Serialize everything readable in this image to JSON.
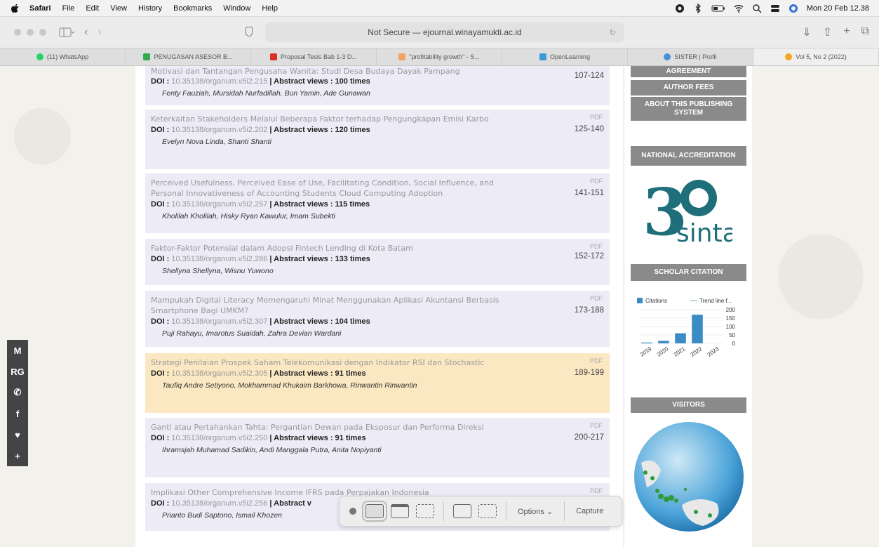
{
  "menubar": {
    "items": [
      "Safari",
      "File",
      "Edit",
      "View",
      "History",
      "Bookmarks",
      "Window",
      "Help"
    ],
    "datetime": "Mon 20 Feb 12.38"
  },
  "toolbar": {
    "address": "Not Secure — ejournal.winayamukti.ac.id"
  },
  "tabs": [
    {
      "label": "(11) WhatsApp",
      "color": "#25d366"
    },
    {
      "label": "PENUGASAN ASESOR B...",
      "color": "#34a853"
    },
    {
      "label": "Proposal Tesis Bab 1-3 D...",
      "color": "#d93025"
    },
    {
      "label": "\"profitability growth\" - S...",
      "color": "#f4a460"
    },
    {
      "label": "OpenLearning",
      "color": "#3a9bd9"
    },
    {
      "label": "SISTER | Profil",
      "color": "#4a90d9"
    },
    {
      "label": "Vol 5, No 2 (2022)",
      "color": "#f5a623"
    }
  ],
  "articles": [
    {
      "title": "Motivasi dan Tantangan Pengusaha Wanita: Studi Desa Budaya Dayak Pampang",
      "pdf": "",
      "pages": "107-124",
      "doi_label": "DOI : ",
      "doi": "10.35138/organum.v5i2.215",
      "views": " | Abstract views : 100 times",
      "authors": "Fenty Fauziah, Mursidah Nurfadillah, Bun Yamin, Ade Gunawan"
    },
    {
      "title": "Keterkaitan Stakeholders Melalui Beberapa Faktor terhadap Pengungkapan Emisi Karbo",
      "pdf": "PDF",
      "pages": "125-140",
      "doi_label": "DOI : ",
      "doi": "10.35138/organum.v5i2.202",
      "views": " | Abstract views : 120 times",
      "authors": "Evelyn Nova Linda, Shanti Shanti"
    },
    {
      "title": "Perceived Usefulness, Perceived Ease of Use, Facilitating Condition, Social Influence, and Personal Innovativeness of Accounting Students Cloud Computing Adoption",
      "pdf": "PDF",
      "pages": "141-151",
      "doi_label": "DOI : ",
      "doi": "10.35138/organum.v5i2.257",
      "views": " | Abstract views : 115 times",
      "authors": "Kholilah Kholilah, Hisky Ryan Kawulur, Imam Subekti"
    },
    {
      "title": "Faktor-Faktor Potensial dalam Adopsi Fintech Lending di Kota Batam",
      "pdf": "PDF",
      "pages": "152-172",
      "doi_label": "DOI : ",
      "doi": "10.35138/organum.v5i2.286",
      "views": " | Abstract views : 133 times",
      "authors": "Shellyna Shellyna, Wisnu Yuwono"
    },
    {
      "title": "Mampukah Digital Literacy Memengaruhi Minat Menggunakan Aplikasi Akuntansi Berbasis Smartphone Bagi UMKM?",
      "pdf": "PDF",
      "pages": "173-188",
      "doi_label": "DOI : ",
      "doi": "10.35138/organum.v5i2.307",
      "views": " | Abstract views : 104 times",
      "authors": "Puji Rahayu, Imarotus Suaidah, Zahra Devian Wardani"
    },
    {
      "title": "Strategi Penilaian Prospek Saham Telekomunikasi dengan Indikator RSI dan Stochastic",
      "pdf": "PDF",
      "pages": "189-199",
      "doi_label": "DOI : ",
      "doi": "10.35138/organum.v5i2.305",
      "views": " | Abstract views : 91 times",
      "authors": "Taufiq Andre Setiyono, Mokhammad Khukaim Barkhowa, Rinwantin Rinwantin"
    },
    {
      "title": "Ganti atau Pertahankan Tahta: Pergantian Dewan pada Eksposur dan Performa Direksi",
      "pdf": "PDF",
      "pages": "200-217",
      "doi_label": "DOI : ",
      "doi": "10.35138/organum.v5i2.250",
      "views": " | Abstract views : 91 times",
      "authors": "Ihramsjah Muhamad Sadikin, Andi Manggala Putra, Anita Nopiyanti"
    },
    {
      "title": "Implikasi Other Comprehensive Income IFRS pada Perpajakan Indonesia",
      "pdf": "PDF",
      "pages": "",
      "doi_label": "DOI : ",
      "doi": "10.35138/organum.v5i2.256",
      "views": " | Abstract v",
      "authors": "Prianto Budi Saptono, Ismail Khozen"
    }
  ],
  "sidebar": {
    "agreement": "AGREEMENT",
    "author_fees": "AUTHOR FEES",
    "about": "ABOUT THIS PUBLISHING SYSTEM",
    "national_accreditation": "NATIONAL ACCREDITATION",
    "sinta_number": "3",
    "sinta_word": "sinta",
    "scholar_citation": "SCHOLAR CITATION",
    "visitors": "VISITORS"
  },
  "chart_data": {
    "type": "bar",
    "categories": [
      "2019",
      "2020",
      "2021",
      "2022",
      "2023"
    ],
    "series": [
      {
        "name": "Citations",
        "values": [
          5,
          15,
          60,
          170,
          0
        ]
      }
    ],
    "legend": [
      "Citations",
      "Trend line f..."
    ],
    "yticks": [
      "200",
      "150",
      "100",
      "50",
      "0"
    ],
    "ylim": [
      0,
      200
    ]
  },
  "share": [
    "M",
    "RG",
    "✆",
    "f",
    "♥",
    "+"
  ],
  "capture": {
    "options_label": "Options ⌄",
    "capture_label": "Capture"
  }
}
